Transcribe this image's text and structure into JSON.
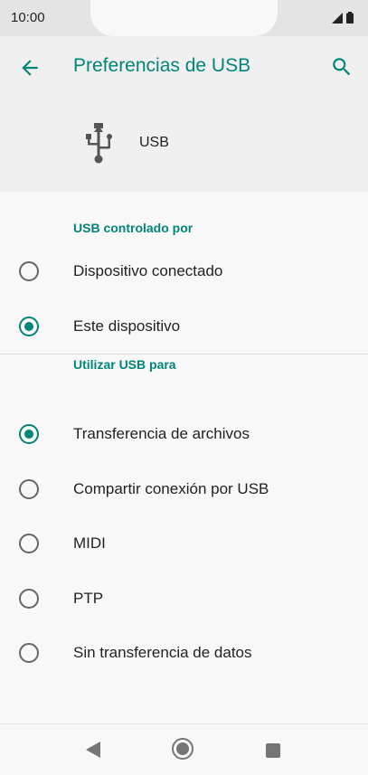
{
  "status_bar": {
    "time": "10:00"
  },
  "header": {
    "title": "Preferencias de USB",
    "device_label": "USB"
  },
  "usb_controlled_by": {
    "title": "USB controlado por",
    "options": [
      {
        "label": "Dispositivo conectado",
        "selected": false
      },
      {
        "label": "Este dispositivo",
        "selected": true
      }
    ]
  },
  "use_usb_for": {
    "title": "Utilizar USB para",
    "options": [
      {
        "label": "Transferencia de archivos",
        "selected": true
      },
      {
        "label": "Compartir conexión por USB",
        "selected": false
      },
      {
        "label": "MIDI",
        "selected": false
      },
      {
        "label": "PTP",
        "selected": false
      },
      {
        "label": "Sin transferencia de datos",
        "selected": false
      }
    ]
  },
  "colors": {
    "accent": "#008577",
    "header_bg": "#f0f0f0",
    "status_bar_bg": "#e4e4e4"
  }
}
